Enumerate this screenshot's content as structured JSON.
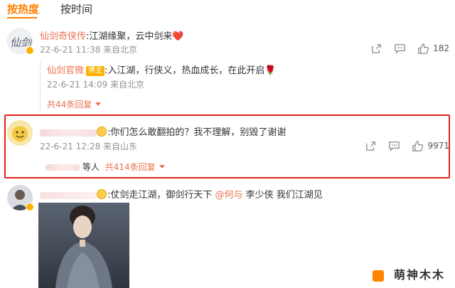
{
  "tabs": {
    "hot": "按热度",
    "time": "按时间"
  },
  "comment1": {
    "user": "仙剑奇侠传",
    "text": ":江湖缘聚，云中剑来",
    "heart": "❤️",
    "meta": "22-6-21 11:38 来自北京",
    "likes": "182"
  },
  "reply1": {
    "user": "仙剑官微",
    "badge": "博主",
    "text": ":入江湖，行侠义，热血成长，在此开启",
    "flower": "🌹",
    "meta": "22-6-21 14:09 来自北京",
    "more": "共44条回复"
  },
  "comment2": {
    "text": ":你们怎么敢翻拍的？我不理解，别毁了谢谢",
    "meta": "22-6-21 12:28 来自山东",
    "likes": "9971",
    "reply_prefix": "等人",
    "more": "共414条回复"
  },
  "comment3": {
    "text1": ":仗剑走江湖，御剑行天下 ",
    "mention": "@何与",
    "text2": " 李少侠 我们江湖见"
  },
  "watermark": "萌神木木",
  "icons": {
    "share": "share-icon",
    "comment": "comment-icon",
    "like": "like-icon"
  },
  "colors": {
    "accent": "#ff8200",
    "username": "#eb7350",
    "highlight": "#e0231e",
    "verified": "#ffb100"
  }
}
